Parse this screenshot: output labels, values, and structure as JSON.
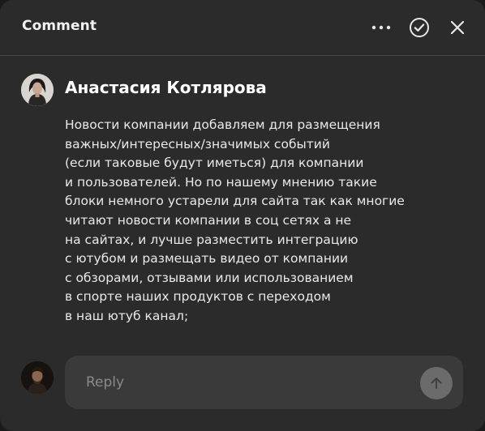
{
  "header": {
    "title": "Comment",
    "icons": {
      "more": "more-dots-icon",
      "resolve": "check-circle-icon",
      "close": "close-icon"
    }
  },
  "comment": {
    "author": "Анастасия Котлярова",
    "text": "Новости компании добавляем для размещения\nважных/интересных/значимых событий\n(если таковые будут иметься) для компании\nи пользователей. Но по нашему мнению такие\nблоки немного устарели для сайта так как многие\nчитают новости компании в соц сетях а не\nна сайтах, и лучше разместить интеграцию\nс ютубом и размещать видео от компании\nс обзорами, отзывами или использованием\nв спорте наших продуктов с переходом\nв наш ютуб канал;"
  },
  "reply": {
    "placeholder": "Reply",
    "value": "",
    "send_icon": "arrow-up-icon"
  },
  "colors": {
    "panel": "#2b2b2b",
    "input": "#3a3a3a",
    "send_button": "#6b6b6b",
    "text": "#e9e9e9"
  }
}
